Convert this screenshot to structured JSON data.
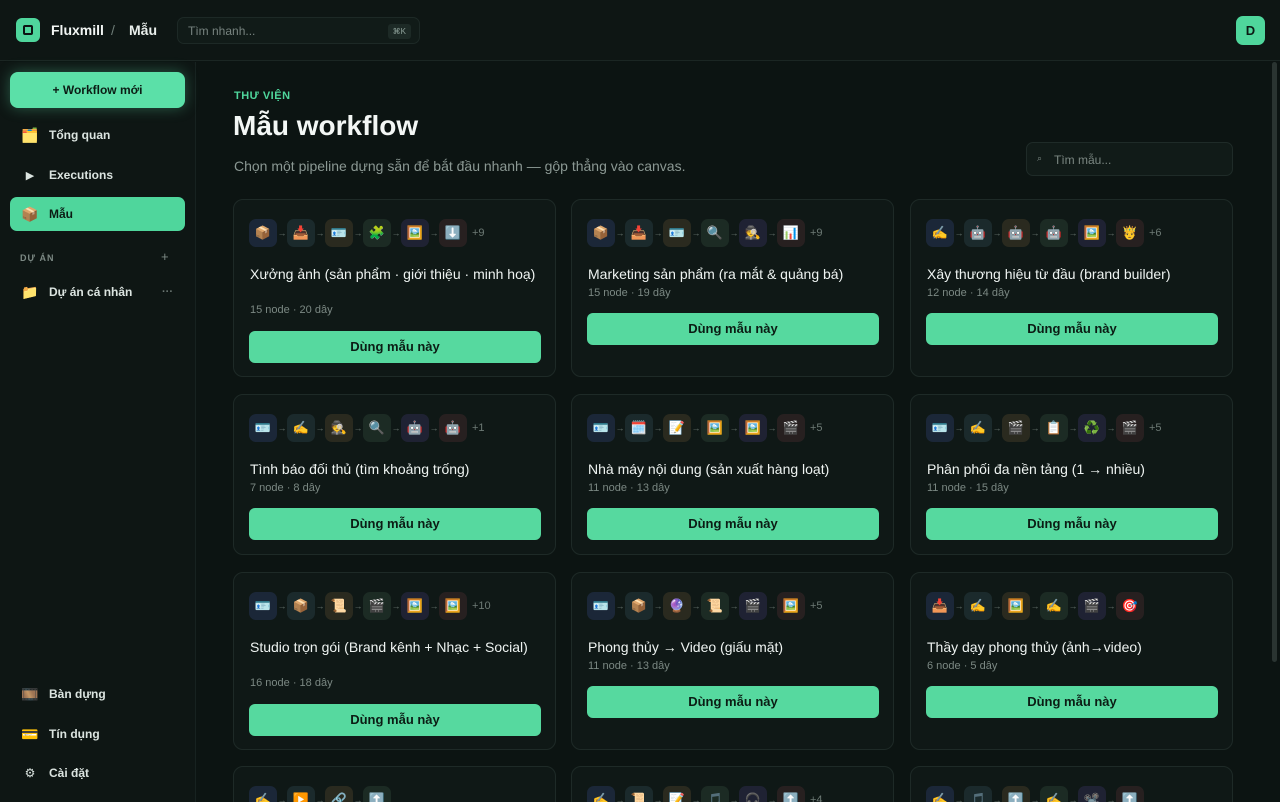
{
  "header": {
    "brand": "Fluxmill",
    "separator": "/",
    "crumb": "Mẫu",
    "search_placeholder": "Tìm nhanh...",
    "search_shortcut": "⌘K",
    "user_initial": "D"
  },
  "sidebar": {
    "new_workflow": "+ Workflow mới",
    "nav": [
      {
        "label": "Tổng quan",
        "icon": "🗂️"
      },
      {
        "label": "Executions",
        "icon": "▶"
      },
      {
        "label": "Mẫu",
        "icon": "📦"
      }
    ],
    "section_label": "DỰ ÁN",
    "section_plus": "+",
    "projects": [
      {
        "label": "Dự án cá nhân",
        "icon": "📁",
        "more": "···"
      }
    ],
    "bottom": [
      {
        "label": "Bàn dựng",
        "icon": "🎞️"
      },
      {
        "label": "Tín dụng",
        "icon": "💳"
      },
      {
        "label": "Cài đặt",
        "icon": "⚙"
      }
    ]
  },
  "main": {
    "eyebrow": "THƯ VIỆN",
    "title": "Mẫu workflow",
    "subtitle": "Chọn một pipeline dựng sẵn để bắt đầu nhanh — gộp thẳng vào canvas.",
    "search_placeholder": "Tìm mẫu..."
  },
  "card_button": "Dùng mẫu này",
  "cards": [
    {
      "title": "Xưởng ảnh (sản phẩm · giới thiệu · minh hoạ)",
      "meta": "15 node · 20 dây",
      "more": "+9",
      "icons": [
        "📦",
        "📥",
        "🪪",
        "🧩",
        "🖼️",
        "⬇️"
      ]
    },
    {
      "title": "Marketing sản phẩm (ra mắt & quảng bá)",
      "meta": "15 node · 19 dây",
      "more": "+9",
      "icons": [
        "📦",
        "📥",
        "🪪",
        "🔍",
        "🕵️",
        "📊"
      ]
    },
    {
      "title": "Xây thương hiệu từ đầu (brand builder)",
      "meta": "12 node · 14 dây",
      "more": "+6",
      "icons": [
        "✍️",
        "🤖",
        "🤖",
        "🤖",
        "🖼️",
        "🤴"
      ]
    },
    {
      "title": "Tình báo đối thủ (tìm khoảng trống)",
      "meta": "7 node · 8 dây",
      "more": "+1",
      "icons": [
        "🪪",
        "✍️",
        "🕵️",
        "🔍",
        "🤖",
        "🤖"
      ]
    },
    {
      "title": "Nhà máy nội dung (sản xuất hàng loạt)",
      "meta": "11 node · 13 dây",
      "more": "+5",
      "icons": [
        "🪪",
        "🗓️",
        "📝",
        "🖼️",
        "🖼️",
        "🎬"
      ]
    },
    {
      "title": "Phân phối đa nền tảng (1 → nhiều)",
      "meta": "11 node · 15 dây",
      "more": "+5",
      "icons": [
        "🪪",
        "✍️",
        "🎬",
        "📋",
        "♻️",
        "🎬"
      ]
    },
    {
      "title": "Studio trọn gói (Brand kênh + Nhạc + Social)",
      "meta": "16 node · 18 dây",
      "more": "+10",
      "icons": [
        "🪪",
        "📦",
        "📜",
        "🎬",
        "🖼️",
        "🖼️"
      ]
    },
    {
      "title": "Phong thủy → Video (giấu mặt)",
      "meta": "11 node · 13 dây",
      "more": "+5",
      "icons": [
        "🪪",
        "📦",
        "🔮",
        "📜",
        "🎬",
        "🖼️"
      ]
    },
    {
      "title": "Thầy dạy phong thủy (ảnh→video)",
      "meta": "6 node · 5 dây",
      "more": "",
      "icons": [
        "📥",
        "✍️",
        "🖼️",
        "✍️",
        "🎬",
        "🎯"
      ]
    },
    {
      "title": "",
      "meta": "",
      "more": "",
      "icons": [
        "✍️",
        "▶️",
        "🔗",
        "⬆️"
      ]
    },
    {
      "title": "",
      "meta": "",
      "more": "+4",
      "icons": [
        "✍️",
        "📜",
        "📝",
        "🎵",
        "🎧",
        "⬆️"
      ]
    },
    {
      "title": "",
      "meta": "",
      "more": "",
      "icons": [
        "✍️",
        "🎵",
        "⬆️",
        "✍️",
        "📽️",
        "⬆️"
      ]
    }
  ]
}
